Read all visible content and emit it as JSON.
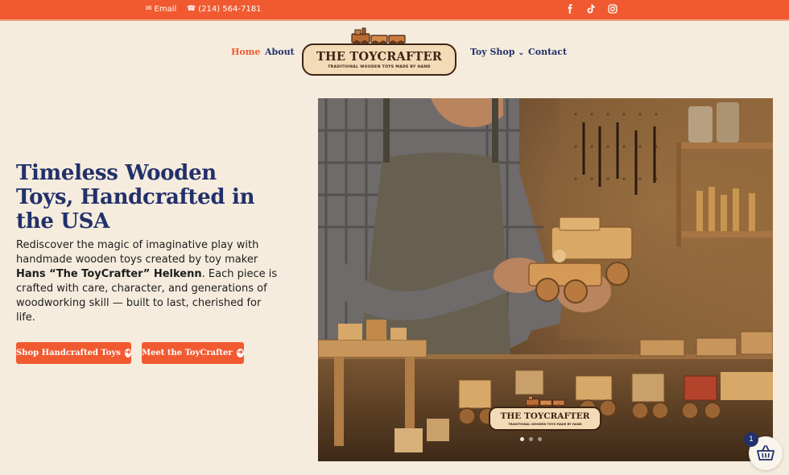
{
  "topbar": {
    "email_label": "Email",
    "phone": "(214) 564-7181",
    "social": [
      "facebook-icon",
      "tiktok-icon",
      "instagram-icon"
    ]
  },
  "nav": {
    "home": "Home",
    "about": "About",
    "toy_shop": "Toy Shop",
    "contact": "Contact"
  },
  "logo": {
    "title": "The ToyCrafter",
    "subtitle": "TRADITIONAL WOODEN TOYS MADE BY HAND"
  },
  "hero": {
    "title_lines": [
      "Timeless Wooden",
      "Toys, Handcrafted in",
      "the USA"
    ],
    "desc_line1": "Rediscover the magic of imaginative play with",
    "desc_line2": "handmade wooden toys created by toy maker",
    "desc_bold": "Hans “The ToyCrafter” Helkenn",
    "desc_line3_rest": ". Each piece is",
    "desc_line4": "crafted with care, character, and generations of",
    "desc_line5": "woodworking skill — built to last, cherished for",
    "desc_line6": "life.",
    "button_shop": "Shop Handcrafted Toys",
    "button_meet": "Meet the ToyCrafter"
  },
  "image_logo": {
    "title": "The ToyCrafter",
    "subtitle": "TRADITIONAL WOODEN TOYS MADE BY HAND"
  },
  "cart": {
    "count": "1"
  },
  "colors": {
    "accent": "#f15a30",
    "navy": "#22306b",
    "background": "#f5ecdd"
  }
}
